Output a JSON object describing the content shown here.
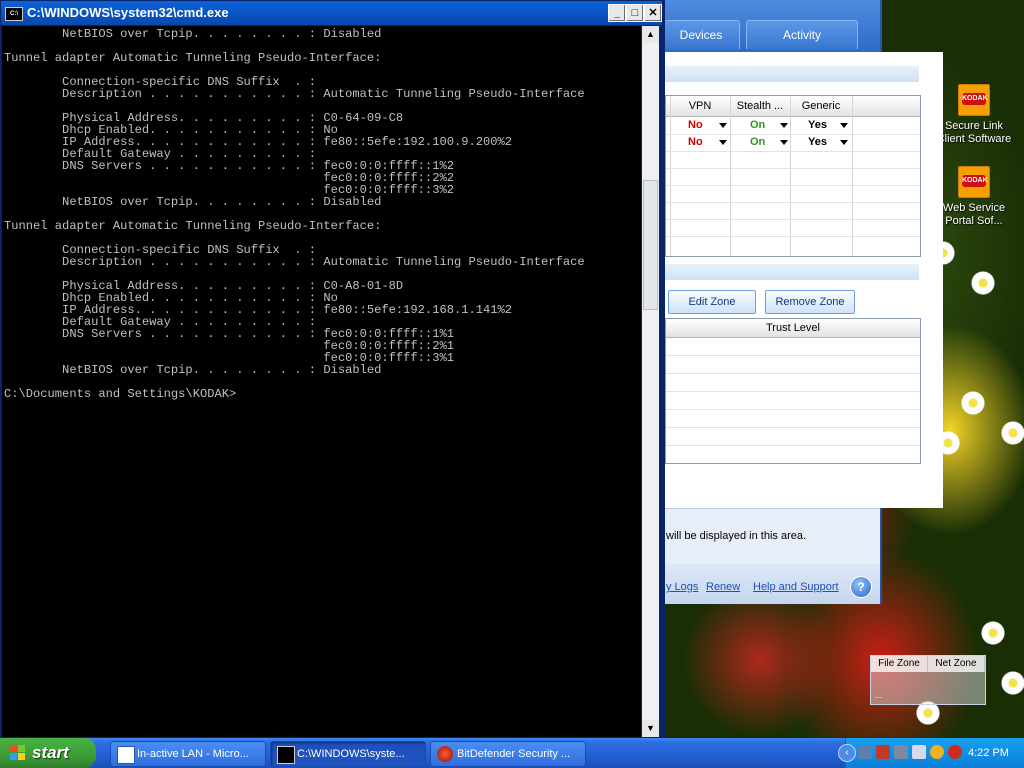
{
  "desktop": {
    "icons": [
      {
        "label": "Secure Link Client Software",
        "logo": "KODAK",
        "icon": "kodak-app-icon"
      },
      {
        "label": "Web Service Portal Sof...",
        "logo": "KODAK",
        "icon": "kodak-app-icon"
      }
    ]
  },
  "bitdefender": {
    "tabs": [
      "Devices",
      "Activity"
    ],
    "zone_table": {
      "columns": [
        "VPN",
        "Stealth ...",
        "Generic"
      ],
      "rows": [
        {
          "vpn": "No",
          "stealth": "On",
          "generic": "Yes"
        },
        {
          "vpn": "No",
          "stealth": "On",
          "generic": "Yes"
        }
      ]
    },
    "buttons": {
      "edit_zone": "Edit Zone",
      "remove_zone": "Remove Zone"
    },
    "trust_table": {
      "header": "Trust Level"
    },
    "info_text": "will be displayed in this area.",
    "links": [
      "y Logs",
      "Renew",
      "Help and Support"
    ],
    "help_glyph": "?",
    "colors": {
      "no": "#cc0000",
      "on": "#2a9a1a",
      "yes": "#000000"
    }
  },
  "zone_widget": {
    "file_zone": "File Zone",
    "net_zone": "Net Zone",
    "dots": "..."
  },
  "cmd": {
    "title": "C:\\WINDOWS\\system32\\cmd.exe",
    "icon_text": "C:\\",
    "controls": {
      "minimize": "_",
      "maximize": "□",
      "close": "✕"
    },
    "output": "        NetBIOS over Tcpip. . . . . . . . : Disabled\n\nTunnel adapter Automatic Tunneling Pseudo-Interface:\n\n        Connection-specific DNS Suffix  . :\n        Description . . . . . . . . . . . : Automatic Tunneling Pseudo-Interface\n\n        Physical Address. . . . . . . . . : C0-64-09-C8\n        Dhcp Enabled. . . . . . . . . . . : No\n        IP Address. . . . . . . . . . . . : fe80::5efe:192.100.9.200%2\n        Default Gateway . . . . . . . . . :\n        DNS Servers . . . . . . . . . . . : fec0:0:0:ffff::1%2\n                                            fec0:0:0:ffff::2%2\n                                            fec0:0:0:ffff::3%2\n        NetBIOS over Tcpip. . . . . . . . : Disabled\n\nTunnel adapter Automatic Tunneling Pseudo-Interface:\n\n        Connection-specific DNS Suffix  . :\n        Description . . . . . . . . . . . : Automatic Tunneling Pseudo-Interface\n\n        Physical Address. . . . . . . . . : C0-A8-01-8D\n        Dhcp Enabled. . . . . . . . . . . : No\n        IP Address. . . . . . . . . . . . : fe80::5efe:192.168.1.141%2\n        Default Gateway . . . . . . . . . :\n        DNS Servers . . . . . . . . . . . : fec0:0:0:ffff::1%1\n                                            fec0:0:0:ffff::2%1\n                                            fec0:0:0:ffff::3%1\n        NetBIOS over Tcpip. . . . . . . . : Disabled\n\nC:\\Documents and Settings\\KODAK>"
  },
  "taskbar": {
    "start_label": "start",
    "tasks": [
      {
        "label": "In-active LAN - Micro...",
        "icon": "word-document-icon",
        "active": false
      },
      {
        "label": "C:\\WINDOWS\\syste...",
        "icon": "cmd-icon",
        "active": true
      },
      {
        "label": "BitDefender Security ...",
        "icon": "bitdefender-icon",
        "active": false
      }
    ],
    "tray_icons": [
      "network-icon",
      "firewall-icon",
      "antivirus-icon",
      "usb-icon",
      "search-icon",
      "bitdefender-tray-icon"
    ],
    "clock": "4:22 PM"
  }
}
